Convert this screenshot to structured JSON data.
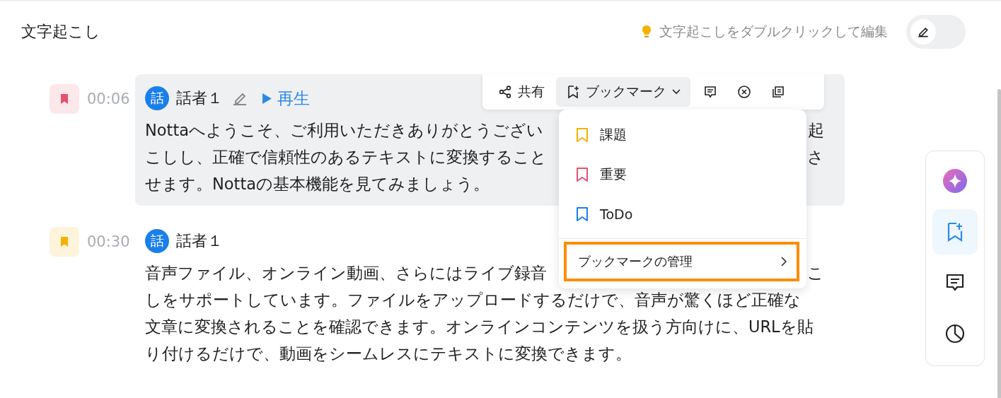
{
  "header": {
    "title": "文字起こし",
    "hint": "文字起こしをダブルクリックして編集",
    "edit_mode": false
  },
  "segments": [
    {
      "color": "#e8506f",
      "time": "00:06",
      "avatar": "話",
      "speaker": "話者１",
      "highlighted": true,
      "play_label": "再生",
      "lines": [
        [
          "Nottaへようこそ、ご利用いただきありがとうござい",
          "起"
        ],
        [
          "こしし、正確で信頼性のあるテキストに変換すること",
          "さ"
        ],
        [
          "せます。Nottaの基本機能を見てみましょう。"
        ]
      ]
    },
    {
      "color": "#f5b100",
      "time": "00:30",
      "avatar": "話",
      "speaker": "話者１",
      "highlighted": false,
      "lines": [
        [
          "音声ファイル、オンライン動画、さらにはライブ録音",
          "こ"
        ],
        [
          "しをサポートしています。ファイルをアップロードするだけで、音声が驚くほど正確な"
        ],
        [
          "文章に変換されることを確認できます。オンラインコンテンツを扱う方向けに、URLを貼"
        ],
        [
          "り付けるだけで、動画をシームレスにテキストに変換できます。"
        ]
      ]
    }
  ],
  "toolbar": {
    "share": "共有",
    "bookmark": "ブックマーク"
  },
  "bookmark_menu": {
    "items": [
      {
        "label": "課題",
        "color": "#f5b100"
      },
      {
        "label": "重要",
        "color": "#e8506f"
      },
      {
        "label": "ToDo",
        "color": "#1a7fe8"
      }
    ],
    "manage": "ブックマークの管理",
    "manage_highlighted": true
  },
  "sidebar": {
    "items": [
      {
        "kind": "ai",
        "selected": false
      },
      {
        "kind": "bookmark",
        "selected": true
      },
      {
        "kind": "comment",
        "selected": false
      },
      {
        "kind": "chart",
        "selected": false
      }
    ]
  }
}
